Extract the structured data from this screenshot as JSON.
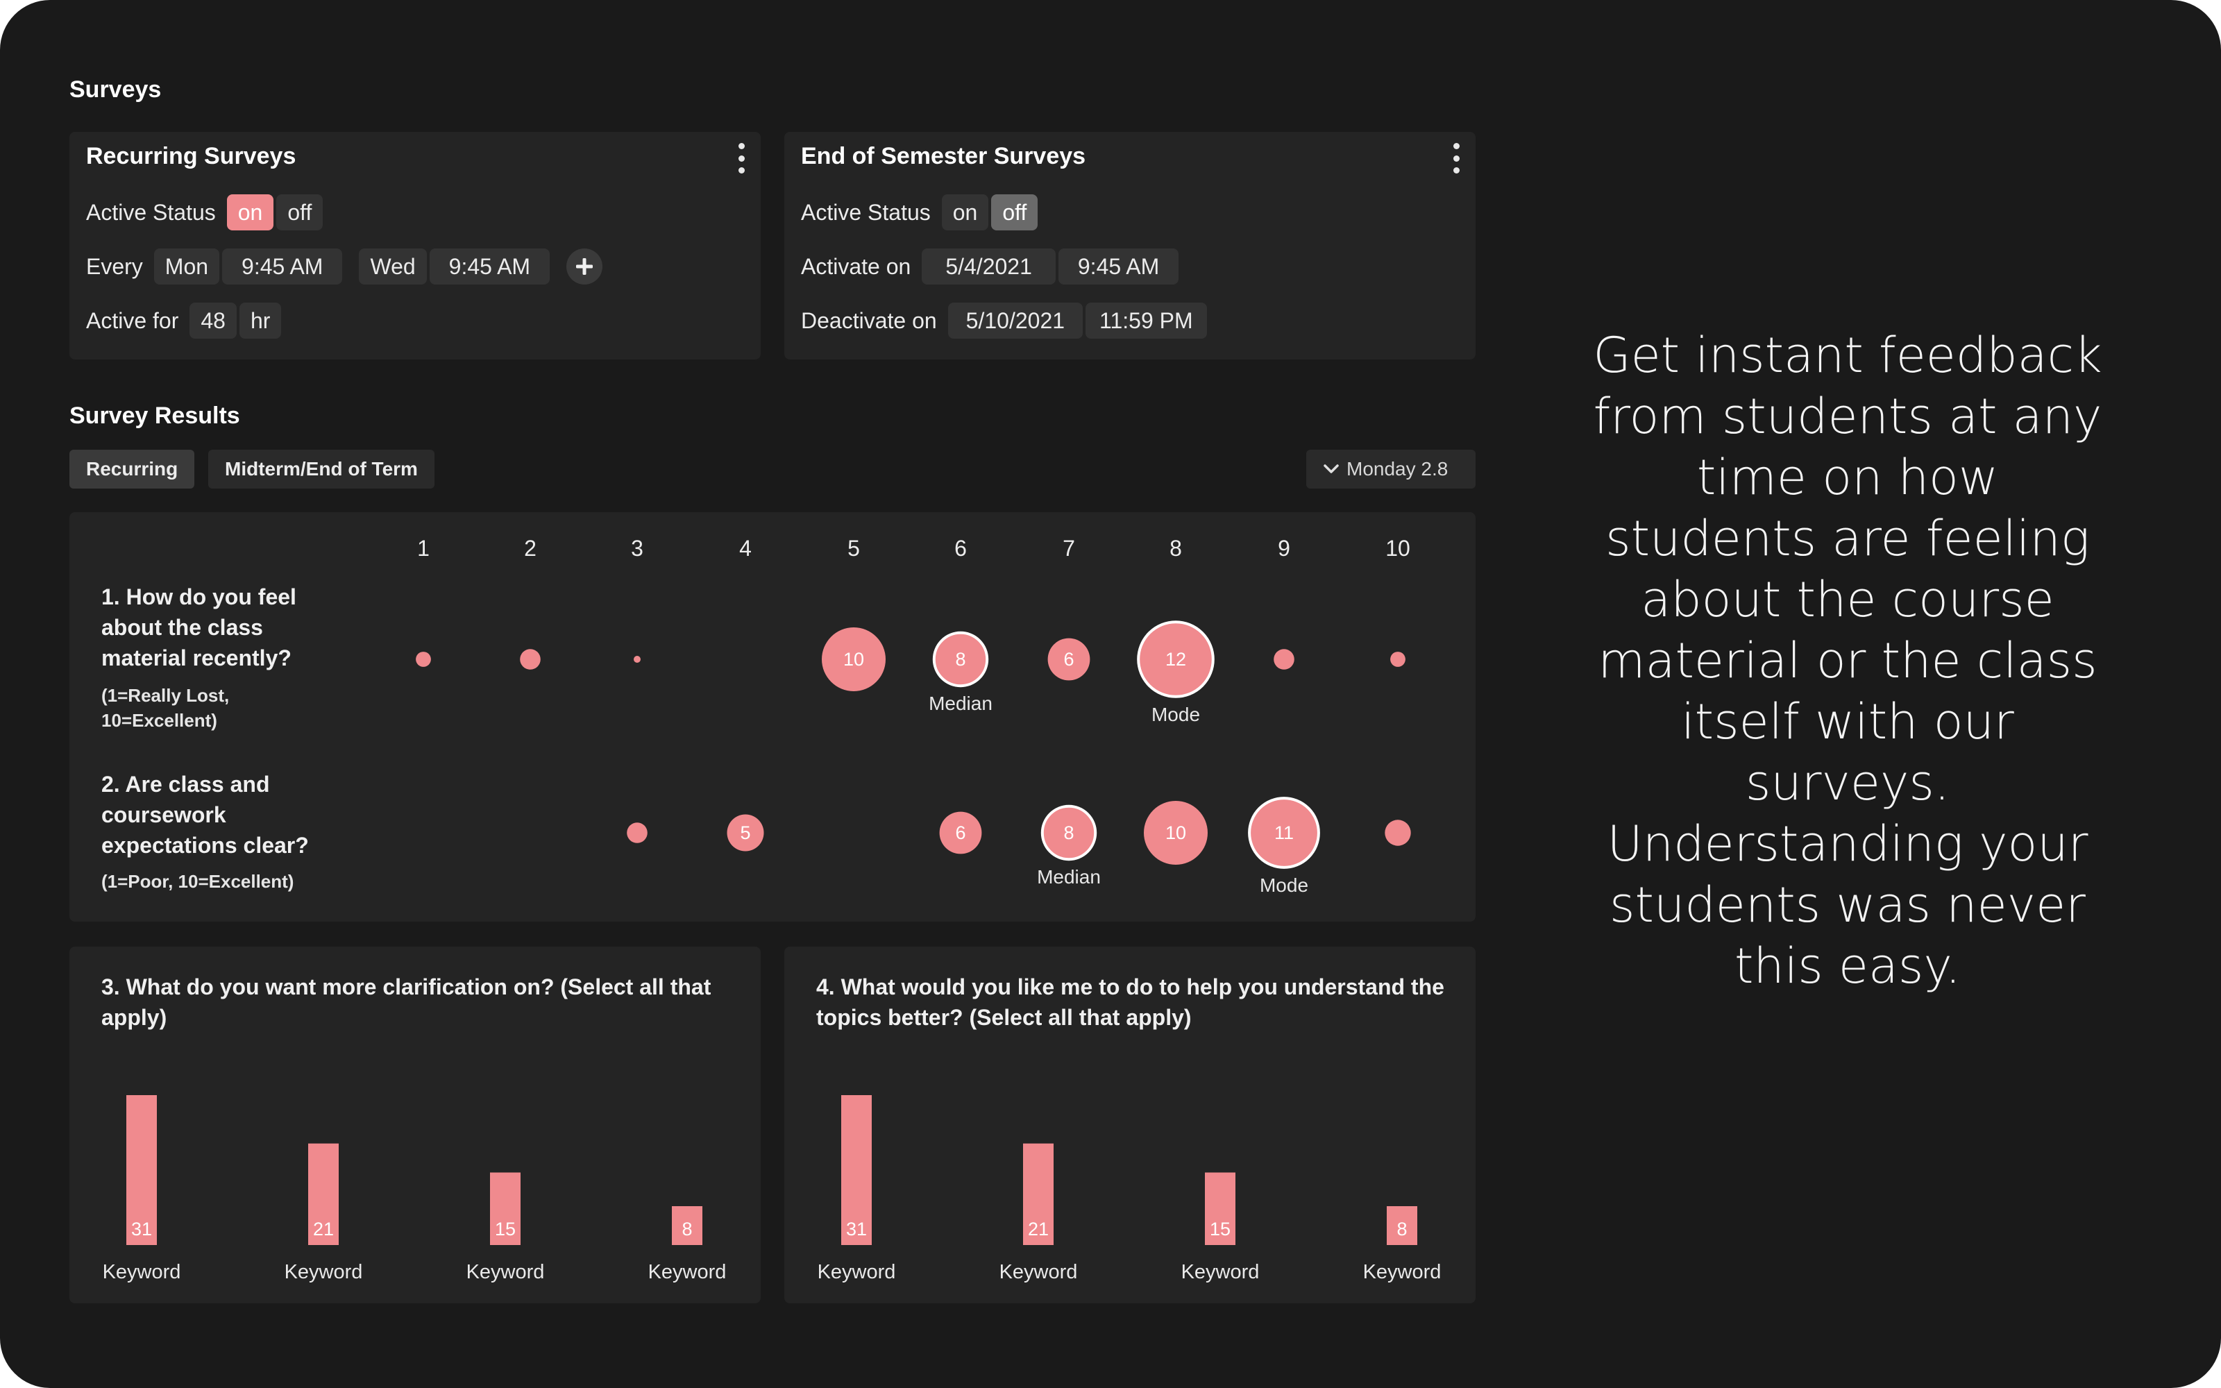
{
  "hint": {
    "text": "Get instant feedback from students at any time on how students are feeling about the course material or the class itself with our surveys. Understanding your students was never this easy."
  },
  "surveys": {
    "title": "Surveys",
    "recurring": {
      "title": "Recurring Surveys",
      "active_status_label": "Active Status",
      "toggle_on": "on",
      "toggle_off": "off",
      "selected": "on",
      "every_label": "Every",
      "schedule": [
        {
          "day": "Mon",
          "time": "9:45 AM"
        },
        {
          "day": "Wed",
          "time": "9:45 AM"
        }
      ],
      "active_for_label": "Active for",
      "active_for_value": "48",
      "active_for_unit": "hr"
    },
    "end_of_semester": {
      "title": "End of Semester Surveys",
      "active_status_label": "Active Status",
      "toggle_on": "on",
      "toggle_off": "off",
      "selected": "off",
      "activate_label": "Activate on",
      "activate_date": "5/4/2021",
      "activate_time": "9:45 AM",
      "deactivate_label": "Deactivate on",
      "deactivate_date": "5/10/2021",
      "deactivate_time": "11:59 PM"
    }
  },
  "results": {
    "title": "Survey Results",
    "tabs": [
      {
        "label": "Recurring",
        "active": true
      },
      {
        "label": "Midterm/End of Term",
        "active": false
      }
    ],
    "date_selector": "Monday 2.8",
    "scale": [
      "1",
      "2",
      "3",
      "4",
      "5",
      "6",
      "7",
      "8",
      "9",
      "10"
    ],
    "questions": [
      {
        "text": "1. How do you feel about the class material recently?",
        "subtext": "(1=Really Lost, 10=Excellent)",
        "counts": [
          1,
          2,
          0.3,
          0,
          10,
          8,
          6,
          12,
          2,
          1
        ],
        "labels": [
          "",
          "",
          "",
          "",
          "10",
          "8",
          "6",
          "12",
          "",
          ""
        ],
        "median_index": 5,
        "mode_index": 7,
        "median_label": "Median",
        "mode_label": "Mode"
      },
      {
        "text": "2. Are class and coursework expectations clear?",
        "subtext": "(1=Poor, 10=Excellent)",
        "counts": [
          0,
          0,
          2,
          5,
          0,
          6,
          8,
          10,
          11,
          3
        ],
        "labels": [
          "",
          "",
          "",
          "5",
          "",
          "6",
          "8",
          "10",
          "11",
          ""
        ],
        "median_index": 6,
        "mode_index": 8,
        "median_label": "Median",
        "mode_label": "Mode"
      }
    ]
  },
  "chart_data": [
    {
      "type": "bar",
      "title": "3. What do you want more clarification on? (Select all that apply)",
      "categories": [
        "Keyword",
        "Keyword",
        "Keyword",
        "Keyword"
      ],
      "values": [
        31,
        21,
        15,
        8
      ]
    },
    {
      "type": "bar",
      "title": "4. What would you like me to do to help you understand the topics better? (Select all that apply)",
      "categories": [
        "Keyword",
        "Keyword",
        "Keyword",
        "Keyword"
      ],
      "values": [
        31,
        21,
        15,
        8
      ]
    }
  ],
  "colors": {
    "accent": "#f08a8e",
    "background": "#1a1a1a",
    "card": "#242424",
    "chip": "#333333"
  }
}
